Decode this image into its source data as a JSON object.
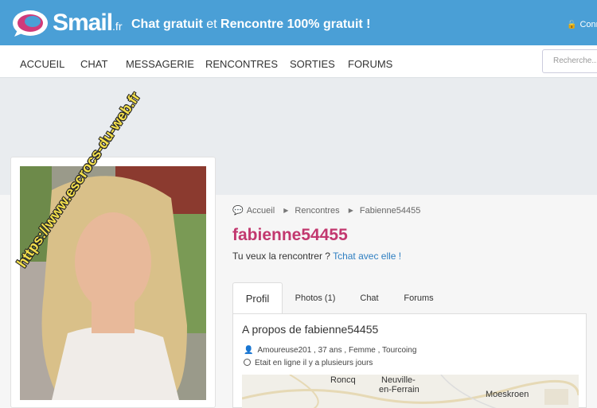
{
  "header": {
    "logo_name": "Smail",
    "logo_tld": ".fr",
    "tagline_part1": "Chat gratuit",
    "tagline_part2": " et ",
    "tagline_part3": "Rencontre 100% gratuit !",
    "connect_label": "Conn",
    "brand_color": "#4a9fd6"
  },
  "nav": {
    "items": [
      "ACCUEIL",
      "CHAT",
      "MESSAGERIE",
      "RENCONTRES",
      "SORTIES",
      "FORUMS"
    ],
    "search_placeholder": "Recherche..."
  },
  "profile": {
    "watermark": "https://www.escrocs-du-web.fr",
    "breadcrumb": [
      "Accueil",
      "Rencontres",
      "Fabienne54455"
    ],
    "username": "fabienne54455",
    "username_color": "#c2386f",
    "invite_text": "Tu veux la rencontrer ? ",
    "invite_link": "Tchat avec elle !",
    "tabs": [
      "Profil",
      "Photos (1)",
      "Chat",
      "Forums"
    ],
    "about_title": "A propos de fabienne54455",
    "info_details": "Amoureuse201 , 37 ans , Femme , Tourcoing",
    "online_status": "Etait en ligne il y a plusieurs jours"
  },
  "map": {
    "labels": [
      "Roncq",
      "Neuville-",
      "en-Ferrain",
      "Moeskroen"
    ]
  }
}
